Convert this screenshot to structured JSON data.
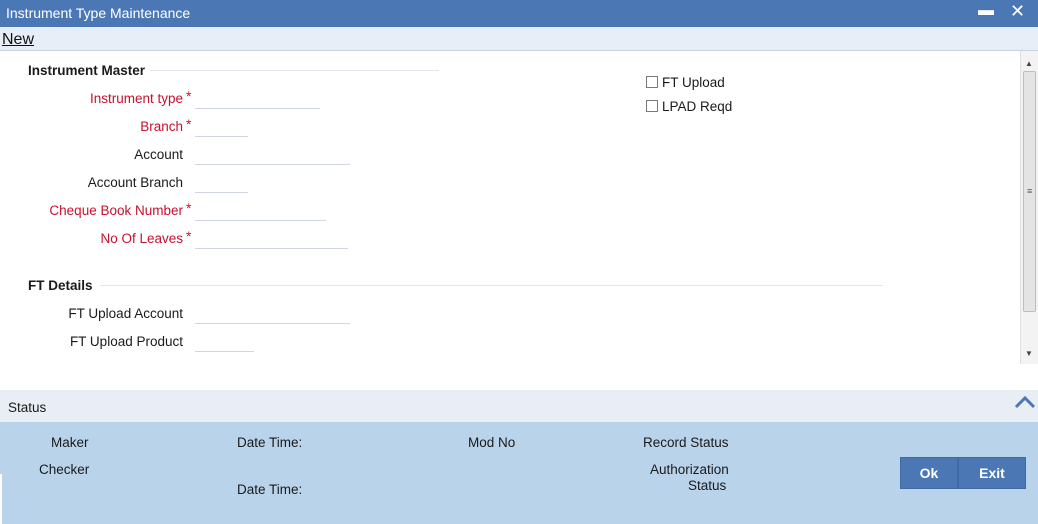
{
  "window": {
    "title": "Instrument Type Maintenance",
    "minimize_glyph": "▬",
    "close_glyph": "✕"
  },
  "toolbar": {
    "new_label": "New"
  },
  "instrument_master": {
    "section_title": "Instrument Master",
    "instrument_type": {
      "label": "Instrument type",
      "value": ""
    },
    "branch": {
      "label": "Branch",
      "value": ""
    },
    "account": {
      "label": "Account",
      "value": ""
    },
    "account_branch": {
      "label": "Account Branch",
      "value": ""
    },
    "cheque_book_number": {
      "label": "Cheque Book Number",
      "value": ""
    },
    "no_of_leaves": {
      "label": "No Of Leaves",
      "value": ""
    },
    "required_mark": "*"
  },
  "options": {
    "ft_upload": {
      "label": "FT Upload",
      "checked": false
    },
    "lpad_reqd": {
      "label": "LPAD Reqd",
      "checked": false
    }
  },
  "ft_details": {
    "section_title": "FT Details",
    "ft_upload_account": {
      "label": "FT Upload Account",
      "value": ""
    },
    "ft_upload_product": {
      "label": "FT Upload Product",
      "value": ""
    }
  },
  "status": {
    "title": "Status",
    "maker": "Maker",
    "checker": "Checker",
    "date_time_1": "Date Time:",
    "date_time_2": "Date Time:",
    "mod_no": "Mod No",
    "record_status": "Record Status",
    "authorization_line1": "Authorization",
    "authorization_line2": "Status"
  },
  "buttons": {
    "ok": "Ok",
    "exit": "Exit"
  },
  "colors": {
    "title_bar": "#4b78b5",
    "required_label": "#c8102e",
    "status_panel": "#b9d3ea",
    "button": "#4b78b5"
  }
}
